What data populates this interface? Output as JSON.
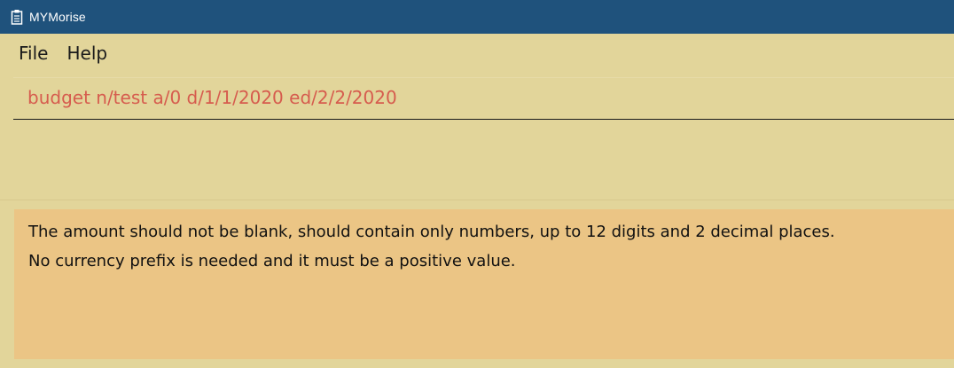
{
  "window": {
    "title": "MYMorise",
    "icon": "clipboard-icon"
  },
  "menu": {
    "items": [
      "File",
      "Help"
    ]
  },
  "command": {
    "text": "budget n/test a/0 d/1/1/2020 ed/2/2/2020"
  },
  "feedback": {
    "lines": [
      "The amount should not be blank,  should contain only numbers, up to 12 digits and 2 decimal places.",
      "No currency prefix is needed and it must be a positive value."
    ]
  },
  "colors": {
    "titlebar": "#1f527c",
    "background": "#e2d59a",
    "command_text": "#d65c4e",
    "feedback_background": "#ebc585"
  }
}
